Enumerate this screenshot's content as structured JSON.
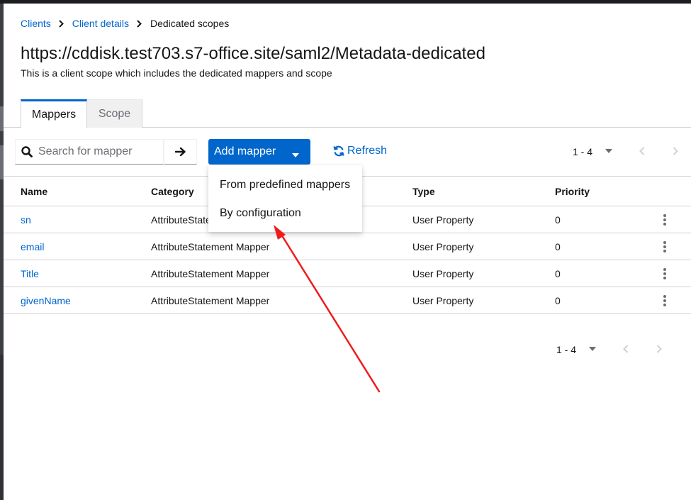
{
  "breadcrumb": [
    {
      "label": "Clients"
    },
    {
      "label": "Client details"
    },
    {
      "label": "Dedicated scopes"
    }
  ],
  "page": {
    "title": "https://cddisk.test703.s7-office.site/saml2/Metadata-dedicated",
    "description": "This is a client scope which includes the dedicated mappers and scope"
  },
  "tabs": [
    {
      "label": "Mappers",
      "active": true
    },
    {
      "label": "Scope",
      "active": false
    }
  ],
  "toolbar": {
    "search_placeholder": "Search for mapper",
    "add_mapper_label": "Add mapper",
    "refresh_label": "Refresh",
    "pagination_top": "1 - 4"
  },
  "dropdown": {
    "items": [
      {
        "label": "From predefined mappers"
      },
      {
        "label": "By configuration"
      }
    ]
  },
  "table": {
    "columns": [
      "Name",
      "Category",
      "Type",
      "Priority"
    ],
    "rows": [
      {
        "name": "sn",
        "category": "AttributeStatement Mapper",
        "type": "User Property",
        "priority": "0"
      },
      {
        "name": "email",
        "category": "AttributeStatement Mapper",
        "type": "User Property",
        "priority": "0"
      },
      {
        "name": "Title",
        "category": "AttributeStatement Mapper",
        "type": "User Property",
        "priority": "0"
      },
      {
        "name": "givenName",
        "category": "AttributeStatement Mapper",
        "type": "User Property",
        "priority": "0"
      }
    ]
  },
  "pagination_bottom": "1 - 4",
  "colors": {
    "accent": "#0066cc",
    "annotation_arrow": "#ee1c1c"
  },
  "icons": {
    "search": "search-icon",
    "go": "arrow-right-icon",
    "caret": "caret-down-icon",
    "refresh": "sync-icon",
    "prev": "angle-left-icon",
    "next": "angle-right-icon",
    "kebab": "kebab-icon"
  }
}
